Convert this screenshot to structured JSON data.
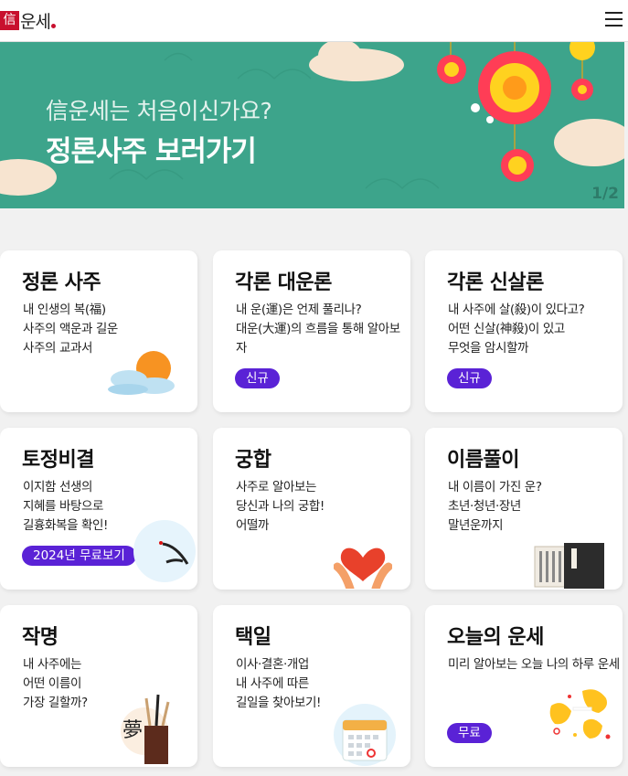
{
  "header": {
    "logo_mark": "信",
    "logo_text": "운세",
    "menu_icon": "hamburger-icon"
  },
  "banner": {
    "line1": "信운세는 처음이신가요?",
    "line2": "정론사주 보러가기",
    "page": "1/2"
  },
  "cards": [
    {
      "title": "정론 사주",
      "desc": "내 인생의 복(福)\n사주의 액운과 길운\n사주의 교과서",
      "badge": "",
      "icon": "sun-cloud-icon"
    },
    {
      "title": "각론 대운론",
      "desc": "내 운(運)은 언제 풀리나?\n대운(大運)의 흐름을 통해 알아보자",
      "badge": "신규",
      "icon": ""
    },
    {
      "title": "각론 신살론",
      "desc": "내 사주에 살(殺)이 있다고?\n어떤 신살(神殺)이 있고\n무엇을 암시할까",
      "badge": "신규",
      "icon": ""
    },
    {
      "title": "토정비결",
      "desc": "이지함 선생의\n지혜를 바탕으로\n길흉화복을 확인!",
      "badge": "2024년 무료보기",
      "icon": "crane-icon"
    },
    {
      "title": "궁합",
      "desc": "사주로 알아보는\n당신과 나의 궁합!\n어떨까",
      "badge": "",
      "icon": "heart-hands-icon"
    },
    {
      "title": "이름풀이",
      "desc": "내 이름이 가진 운?\n초년·청년·장년\n말년운까지",
      "badge": "",
      "icon": "book-icon"
    },
    {
      "title": "작명",
      "desc": "내 사주에는\n어떤 이름이\n가장 길할까?",
      "badge": "",
      "icon": "brush-holder-icon"
    },
    {
      "title": "택일",
      "desc": "이사·결혼·개업\n내 사주에 따른\n길일을 찾아보기!",
      "badge": "",
      "icon": "calendar-icon"
    },
    {
      "title": "오늘의 운세",
      "desc": "미리 알아보는 오늘 나의 하루 운세",
      "badge": "무료",
      "icon": "fortune-cookie-icon"
    }
  ]
}
